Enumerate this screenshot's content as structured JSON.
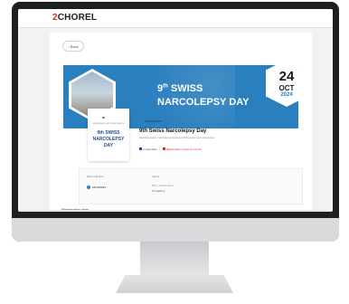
{
  "app": {
    "logo_prefix": "2",
    "logo_text": "CHOREL"
  },
  "nav": {
    "back_label": "Back"
  },
  "banner": {
    "title_line1_number": "9",
    "title_line1_sup": "th",
    "title_line1_rest": " SWISS",
    "title_line2": "NARCOLEPSY DAY",
    "date_day": "24",
    "date_month": "OCT",
    "date_year": "2024",
    "color": "#2a7fbe"
  },
  "event_card": {
    "small_text": "SWISS NARCOLEPSY ASSOCIATION",
    "line1": "9th SWISS",
    "line2": "NARCOLEPSY",
    "line3": "DAY"
  },
  "event": {
    "badge": "SCHEDULED",
    "name": "9th Swiss Narcolepsy Day",
    "url": "www.european-narcolepsy.org/event/9th-swiss-narcolepsy-day",
    "meta_participants": "0 attendees",
    "meta_status": "Registration closes on 23 Oct"
  },
  "details": {
    "date_label": "Date and time",
    "venue_label": "Venue",
    "date_value": "24/10/2024",
    "venue_line1": "Bern, Switzerland",
    "venue_line2": "0 locations"
  },
  "registration": {
    "label": "Registration fees"
  }
}
